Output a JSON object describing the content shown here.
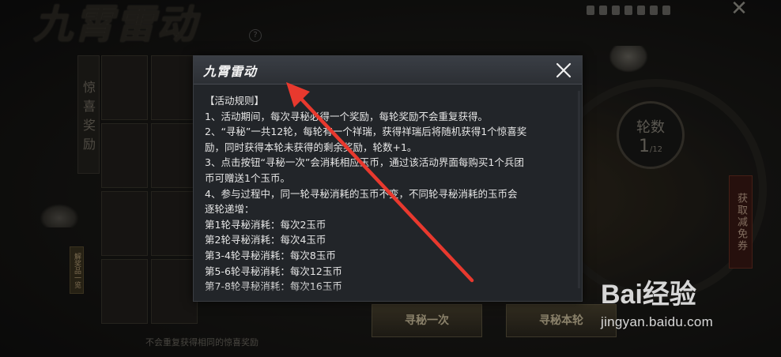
{
  "background": {
    "game_title": "九霄雷动",
    "help_icon": "question-circle-icon",
    "side_label": "惊喜奖励",
    "rank_label": "解奖品一览",
    "round_label": "轮数",
    "round_value": "1",
    "round_total": "/12",
    "side_tag": "获取减免券",
    "button_once": "寻秘一次",
    "button_round": "寻秘本轮",
    "note": "不会重复获得相同的惊喜奖励"
  },
  "modal": {
    "title": "九霄雷动",
    "close_icon": "close-icon",
    "lines": [
      "【活动规则】",
      "1、活动期间，每次寻秘必得一个奖励，每轮奖励不会重复获得。",
      "2、“寻秘”一共12轮，每轮有一个祥瑞，获得祥瑞后将随机获得1个惊喜奖",
      "励，同时获得本轮未获得的剩余奖励，轮数+1。",
      "3、点击按钮“寻秘一次”会消耗相应玉币，通过该活动界面每购买1个兵团",
      "币可赠送1个玉币。",
      "4、参与过程中，同一轮寻秘消耗的玉币不变，不同轮寻秘消耗的玉币会",
      "逐轮递增：",
      "第1轮寻秘消耗：每次2玉币",
      "第2轮寻秘消耗：每次4玉币",
      "第3-4轮寻秘消耗：每次8玉币",
      "第5-6轮寻秘消耗：每次12玉币",
      "第7-8轮寻秘消耗：每次16玉币"
    ]
  },
  "watermark": {
    "logo": "Bai经验",
    "url": "jingyan.baidu.com"
  },
  "colors": {
    "modal_bg": "#222529",
    "header_bg": "#33373d",
    "arrow": "#e8392e"
  }
}
